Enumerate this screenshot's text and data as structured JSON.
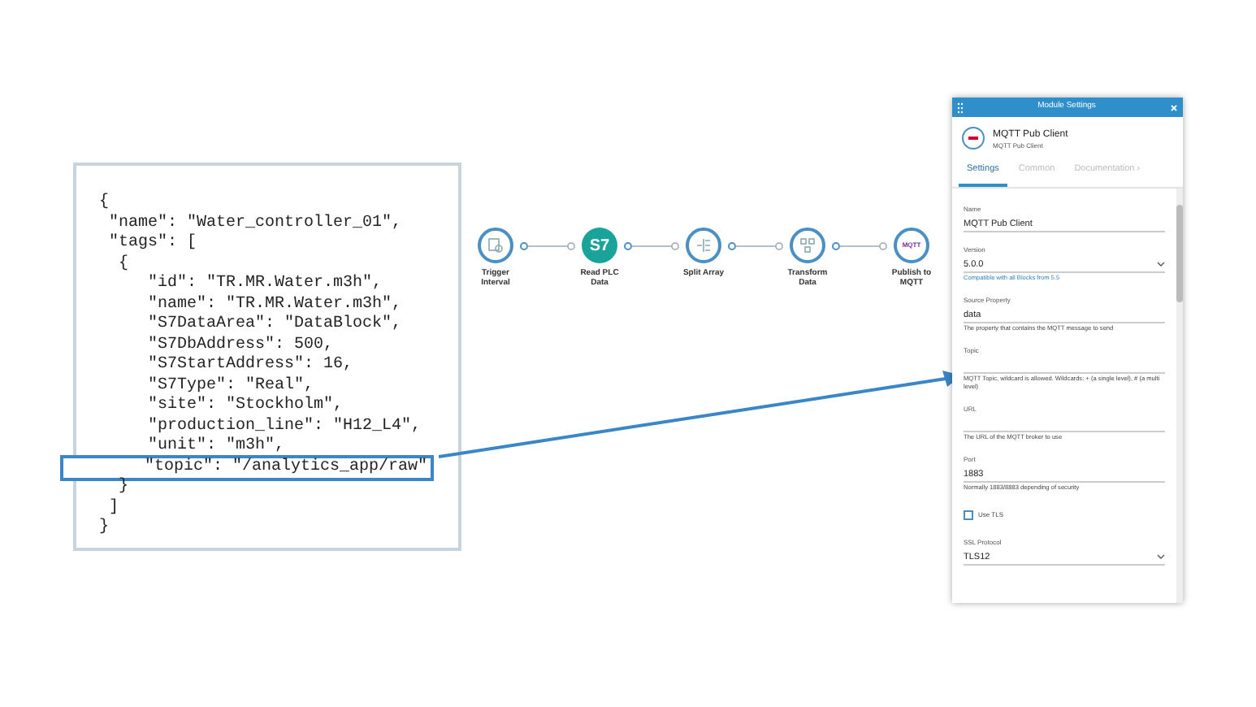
{
  "code_box": {
    "lines": [
      {
        "text": "{",
        "highlighted": false
      },
      {
        "text": " \"name\": \"Water_controller_01\",",
        "highlighted": false
      },
      {
        "text": " \"tags\": [",
        "highlighted": false
      },
      {
        "text": "  {",
        "highlighted": false
      },
      {
        "text": "     \"id\": \"TR.MR.Water.m3h\",",
        "highlighted": false
      },
      {
        "text": "     \"name\": \"TR.MR.Water.m3h\",",
        "highlighted": false
      },
      {
        "text": "     \"S7DataArea\": \"DataBlock\",",
        "highlighted": false
      },
      {
        "text": "     \"S7DbAddress\": 500,",
        "highlighted": false
      },
      {
        "text": "     \"S7StartAddress\": 16,",
        "highlighted": false
      },
      {
        "text": "     \"S7Type\": \"Real\",",
        "highlighted": false
      },
      {
        "text": "     \"site\": \"Stockholm\",",
        "highlighted": false
      },
      {
        "text": "     \"production_line\": \"H12_L4\",",
        "highlighted": false
      },
      {
        "text": "     \"unit\": \"m3h\",",
        "highlighted": false
      },
      {
        "text": "     \"topic\": \"/analytics_app/raw\"",
        "highlighted": true
      },
      {
        "text": "  }",
        "highlighted": false
      },
      {
        "text": " ]",
        "highlighted": false
      },
      {
        "text": "}",
        "highlighted": false
      }
    ]
  },
  "flow": {
    "nodes": [
      {
        "kind": "trigger",
        "label": "Trigger Interval"
      },
      {
        "kind": "s7",
        "badge": "S7",
        "label": "Read PLC Data"
      },
      {
        "kind": "split",
        "label": "Split Array"
      },
      {
        "kind": "transform",
        "label": "Transform Data"
      },
      {
        "kind": "mqtt",
        "badge": "MQTT",
        "label": "Publish to MQTT"
      }
    ]
  },
  "panel": {
    "title": "Module Settings",
    "module_name": "MQTT Pub Client",
    "module_subtitle": "MQTT Pub Client",
    "tabs": [
      {
        "label": "Settings",
        "selected": true
      },
      {
        "label": "Common",
        "selected": false
      },
      {
        "label": "Documentation ›",
        "selected": false
      }
    ],
    "fields": [
      {
        "kind": "text",
        "label": "Name",
        "value": "MQTT Pub Client"
      },
      {
        "kind": "select",
        "label": "Version",
        "value": "5.0.0",
        "help": "Compatible with all Blocks from 5.5",
        "help_link": true
      },
      {
        "kind": "text",
        "label": "Source Property",
        "value": "data",
        "help": "The property that contains the MQTT message to send",
        "help_link": false
      },
      {
        "kind": "text",
        "label": "Topic",
        "help": "MQTT Topic, wildcard is allowed. Wildcards: + (a single level), # (a multi level)",
        "help_link": false
      },
      {
        "kind": "text",
        "label": "URL",
        "help": "The URL of the MQTT broker to use",
        "help_link": false
      },
      {
        "kind": "text",
        "label": "Port",
        "value": "1883",
        "help": "Normally 1883/8883 depending of security",
        "help_link": false
      },
      {
        "kind": "checkbox",
        "label": "Use TLS",
        "checked": false
      },
      {
        "kind": "select",
        "label": "SSL Protocol",
        "value": "TLS12"
      }
    ]
  }
}
